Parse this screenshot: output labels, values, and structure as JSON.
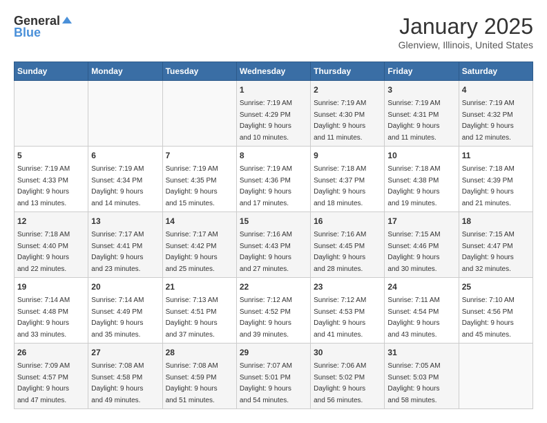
{
  "logo": {
    "general": "General",
    "blue": "Blue"
  },
  "title": "January 2025",
  "subtitle": "Glenview, Illinois, United States",
  "days_of_week": [
    "Sunday",
    "Monday",
    "Tuesday",
    "Wednesday",
    "Thursday",
    "Friday",
    "Saturday"
  ],
  "weeks": [
    [
      {
        "day": "",
        "info": ""
      },
      {
        "day": "",
        "info": ""
      },
      {
        "day": "",
        "info": ""
      },
      {
        "day": "1",
        "info": "Sunrise: 7:19 AM\nSunset: 4:29 PM\nDaylight: 9 hours\nand 10 minutes."
      },
      {
        "day": "2",
        "info": "Sunrise: 7:19 AM\nSunset: 4:30 PM\nDaylight: 9 hours\nand 11 minutes."
      },
      {
        "day": "3",
        "info": "Sunrise: 7:19 AM\nSunset: 4:31 PM\nDaylight: 9 hours\nand 11 minutes."
      },
      {
        "day": "4",
        "info": "Sunrise: 7:19 AM\nSunset: 4:32 PM\nDaylight: 9 hours\nand 12 minutes."
      }
    ],
    [
      {
        "day": "5",
        "info": "Sunrise: 7:19 AM\nSunset: 4:33 PM\nDaylight: 9 hours\nand 13 minutes."
      },
      {
        "day": "6",
        "info": "Sunrise: 7:19 AM\nSunset: 4:34 PM\nDaylight: 9 hours\nand 14 minutes."
      },
      {
        "day": "7",
        "info": "Sunrise: 7:19 AM\nSunset: 4:35 PM\nDaylight: 9 hours\nand 15 minutes."
      },
      {
        "day": "8",
        "info": "Sunrise: 7:19 AM\nSunset: 4:36 PM\nDaylight: 9 hours\nand 17 minutes."
      },
      {
        "day": "9",
        "info": "Sunrise: 7:18 AM\nSunset: 4:37 PM\nDaylight: 9 hours\nand 18 minutes."
      },
      {
        "day": "10",
        "info": "Sunrise: 7:18 AM\nSunset: 4:38 PM\nDaylight: 9 hours\nand 19 minutes."
      },
      {
        "day": "11",
        "info": "Sunrise: 7:18 AM\nSunset: 4:39 PM\nDaylight: 9 hours\nand 21 minutes."
      }
    ],
    [
      {
        "day": "12",
        "info": "Sunrise: 7:18 AM\nSunset: 4:40 PM\nDaylight: 9 hours\nand 22 minutes."
      },
      {
        "day": "13",
        "info": "Sunrise: 7:17 AM\nSunset: 4:41 PM\nDaylight: 9 hours\nand 23 minutes."
      },
      {
        "day": "14",
        "info": "Sunrise: 7:17 AM\nSunset: 4:42 PM\nDaylight: 9 hours\nand 25 minutes."
      },
      {
        "day": "15",
        "info": "Sunrise: 7:16 AM\nSunset: 4:43 PM\nDaylight: 9 hours\nand 27 minutes."
      },
      {
        "day": "16",
        "info": "Sunrise: 7:16 AM\nSunset: 4:45 PM\nDaylight: 9 hours\nand 28 minutes."
      },
      {
        "day": "17",
        "info": "Sunrise: 7:15 AM\nSunset: 4:46 PM\nDaylight: 9 hours\nand 30 minutes."
      },
      {
        "day": "18",
        "info": "Sunrise: 7:15 AM\nSunset: 4:47 PM\nDaylight: 9 hours\nand 32 minutes."
      }
    ],
    [
      {
        "day": "19",
        "info": "Sunrise: 7:14 AM\nSunset: 4:48 PM\nDaylight: 9 hours\nand 33 minutes."
      },
      {
        "day": "20",
        "info": "Sunrise: 7:14 AM\nSunset: 4:49 PM\nDaylight: 9 hours\nand 35 minutes."
      },
      {
        "day": "21",
        "info": "Sunrise: 7:13 AM\nSunset: 4:51 PM\nDaylight: 9 hours\nand 37 minutes."
      },
      {
        "day": "22",
        "info": "Sunrise: 7:12 AM\nSunset: 4:52 PM\nDaylight: 9 hours\nand 39 minutes."
      },
      {
        "day": "23",
        "info": "Sunrise: 7:12 AM\nSunset: 4:53 PM\nDaylight: 9 hours\nand 41 minutes."
      },
      {
        "day": "24",
        "info": "Sunrise: 7:11 AM\nSunset: 4:54 PM\nDaylight: 9 hours\nand 43 minutes."
      },
      {
        "day": "25",
        "info": "Sunrise: 7:10 AM\nSunset: 4:56 PM\nDaylight: 9 hours\nand 45 minutes."
      }
    ],
    [
      {
        "day": "26",
        "info": "Sunrise: 7:09 AM\nSunset: 4:57 PM\nDaylight: 9 hours\nand 47 minutes."
      },
      {
        "day": "27",
        "info": "Sunrise: 7:08 AM\nSunset: 4:58 PM\nDaylight: 9 hours\nand 49 minutes."
      },
      {
        "day": "28",
        "info": "Sunrise: 7:08 AM\nSunset: 4:59 PM\nDaylight: 9 hours\nand 51 minutes."
      },
      {
        "day": "29",
        "info": "Sunrise: 7:07 AM\nSunset: 5:01 PM\nDaylight: 9 hours\nand 54 minutes."
      },
      {
        "day": "30",
        "info": "Sunrise: 7:06 AM\nSunset: 5:02 PM\nDaylight: 9 hours\nand 56 minutes."
      },
      {
        "day": "31",
        "info": "Sunrise: 7:05 AM\nSunset: 5:03 PM\nDaylight: 9 hours\nand 58 minutes."
      },
      {
        "day": "",
        "info": ""
      }
    ]
  ]
}
